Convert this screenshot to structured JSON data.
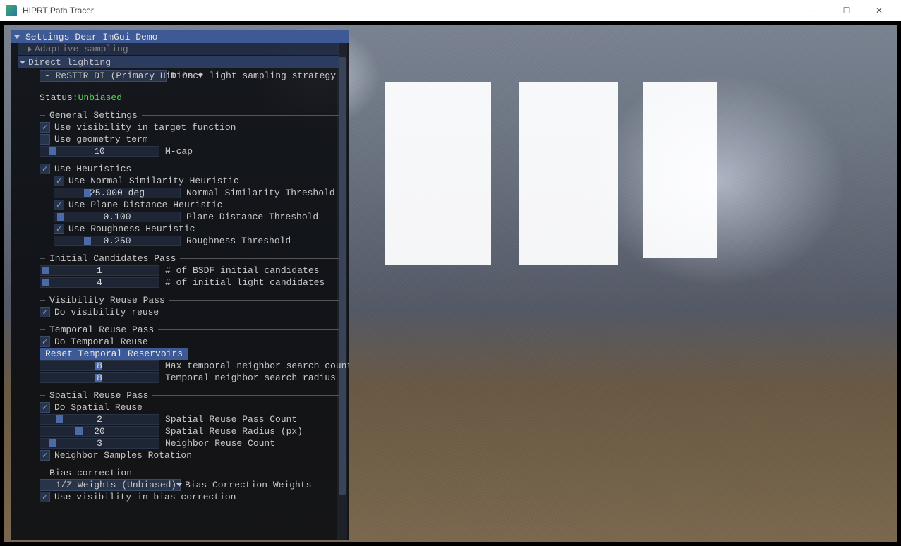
{
  "window": {
    "title": "HIPRT Path Tracer"
  },
  "menu": {
    "settings": "Settings",
    "demo": "Dear ImGui Demo"
  },
  "adaptive": {
    "label": "Adaptive sampling"
  },
  "direct_lighting": {
    "header": "Direct lighting",
    "strategy_combo": "- ReSTIR DI (Primary Hit On",
    "strategy_label": "Direct light sampling strategy",
    "status_label": "Status: ",
    "status_value": "Unbiased"
  },
  "general": {
    "header": "General Settings",
    "vis_target": "Use visibility in target function",
    "geom_term": "Use geometry term",
    "mcap_value": "10",
    "mcap_label": "M-cap"
  },
  "heuristics": {
    "use": "Use Heuristics",
    "normal": "Use Normal Similarity Heuristic",
    "normal_thresh_val": "25.000 deg",
    "normal_thresh_label": "Normal Similarity Threshold",
    "plane": "Use Plane Distance Heuristic",
    "plane_thresh_val": "0.100",
    "plane_thresh_label": "Plane Distance Threshold",
    "rough": "Use Roughness Heuristic",
    "rough_thresh_val": "0.250",
    "rough_thresh_label": "Roughness Threshold"
  },
  "initial": {
    "header": "Initial Candidates Pass",
    "bsdf_val": "1",
    "bsdf_label": "# of BSDF initial candidates",
    "light_val": "4",
    "light_label": "# of initial light candidates"
  },
  "visibility_reuse": {
    "header": "Visibility Reuse Pass",
    "do": "Do visibility reuse"
  },
  "temporal": {
    "header": "Temporal Reuse Pass",
    "do": "Do Temporal Reuse",
    "reset": "Reset Temporal Reservoirs",
    "max_search_val": "8",
    "max_search_label": "Max temporal neighbor search count",
    "radius_val": "8",
    "radius_label": "Temporal neighbor search radius"
  },
  "spatial": {
    "header": "Spatial Reuse Pass",
    "do": "Do Spatial Reuse",
    "count_val": "2",
    "count_label": "Spatial Reuse Pass Count",
    "radius_val": "20",
    "radius_label": "Spatial Reuse Radius (px)",
    "neighbor_val": "3",
    "neighbor_label": "Neighbor Reuse Count",
    "rotation": "Neighbor Samples Rotation"
  },
  "bias": {
    "header": "Bias correction",
    "combo": "- 1/Z Weights (Unbiased)",
    "combo_label": "Bias Correction Weights",
    "vis": "Use visibility in bias correction"
  }
}
